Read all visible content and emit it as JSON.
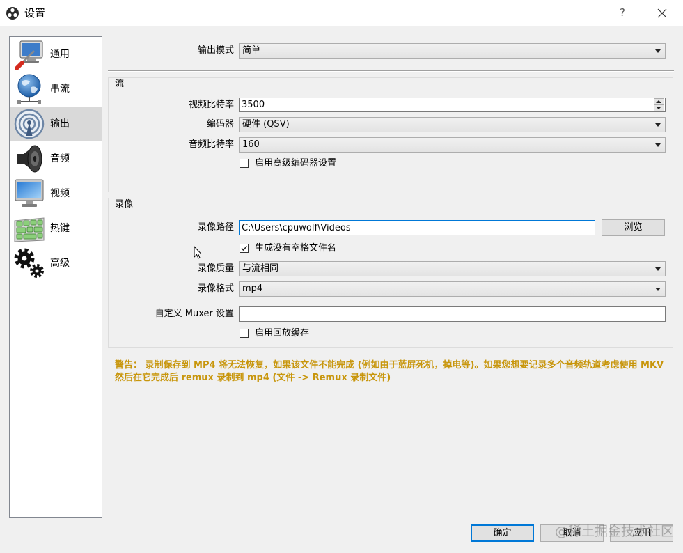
{
  "window": {
    "title": "设置",
    "help_label": "?"
  },
  "sidebar": {
    "items": [
      {
        "label": "通用",
        "icon": "general-icon",
        "selected": false
      },
      {
        "label": "串流",
        "icon": "stream-icon",
        "selected": false
      },
      {
        "label": "输出",
        "icon": "output-icon",
        "selected": true
      },
      {
        "label": "音频",
        "icon": "audio-icon",
        "selected": false
      },
      {
        "label": "视频",
        "icon": "video-icon",
        "selected": false
      },
      {
        "label": "热键",
        "icon": "hotkeys-icon",
        "selected": false
      },
      {
        "label": "高级",
        "icon": "advanced-icon",
        "selected": false
      }
    ]
  },
  "output": {
    "mode_label": "输出模式",
    "mode_value": "简单",
    "streaming": {
      "title": "流",
      "video_bitrate_label": "视频比特率",
      "video_bitrate_value": "3500",
      "encoder_label": "编码器",
      "encoder_value": "硬件 (QSV)",
      "audio_bitrate_label": "音频比特率",
      "audio_bitrate_value": "160",
      "advanced_encoder_label": "启用高级编码器设置",
      "advanced_encoder_checked": false
    },
    "recording": {
      "title": "录像",
      "path_label": "录像路径",
      "path_value": "C:\\Users\\cpuwolf\\Videos",
      "browse_label": "浏览",
      "no_space_label": "生成没有空格文件名",
      "no_space_checked": true,
      "quality_label": "录像质量",
      "quality_value": "与流相同",
      "format_label": "录像格式",
      "format_value": "mp4",
      "muxer_label": "自定义 Muxer 设置",
      "muxer_value": "",
      "replay_buffer_label": "启用回放缓存",
      "replay_buffer_checked": false
    },
    "warning": "警告： 录制保存到 MP4 将无法恢复，如果该文件不能完成 (例如由于蓝屏死机，掉电等)。如果您想要记录多个音频轨道考虑使用 MKV 然后在它完成后 remux 录制到 mp4 (文件 -> Remux 录制文件)"
  },
  "footer": {
    "ok_label": "确定",
    "cancel_label": "取消",
    "apply_label": "应用"
  },
  "watermark": "@稀土掘金技术社区",
  "colors": {
    "warning": "#c8960c",
    "focus": "#0078d7",
    "selected": "#d9d9d9"
  }
}
